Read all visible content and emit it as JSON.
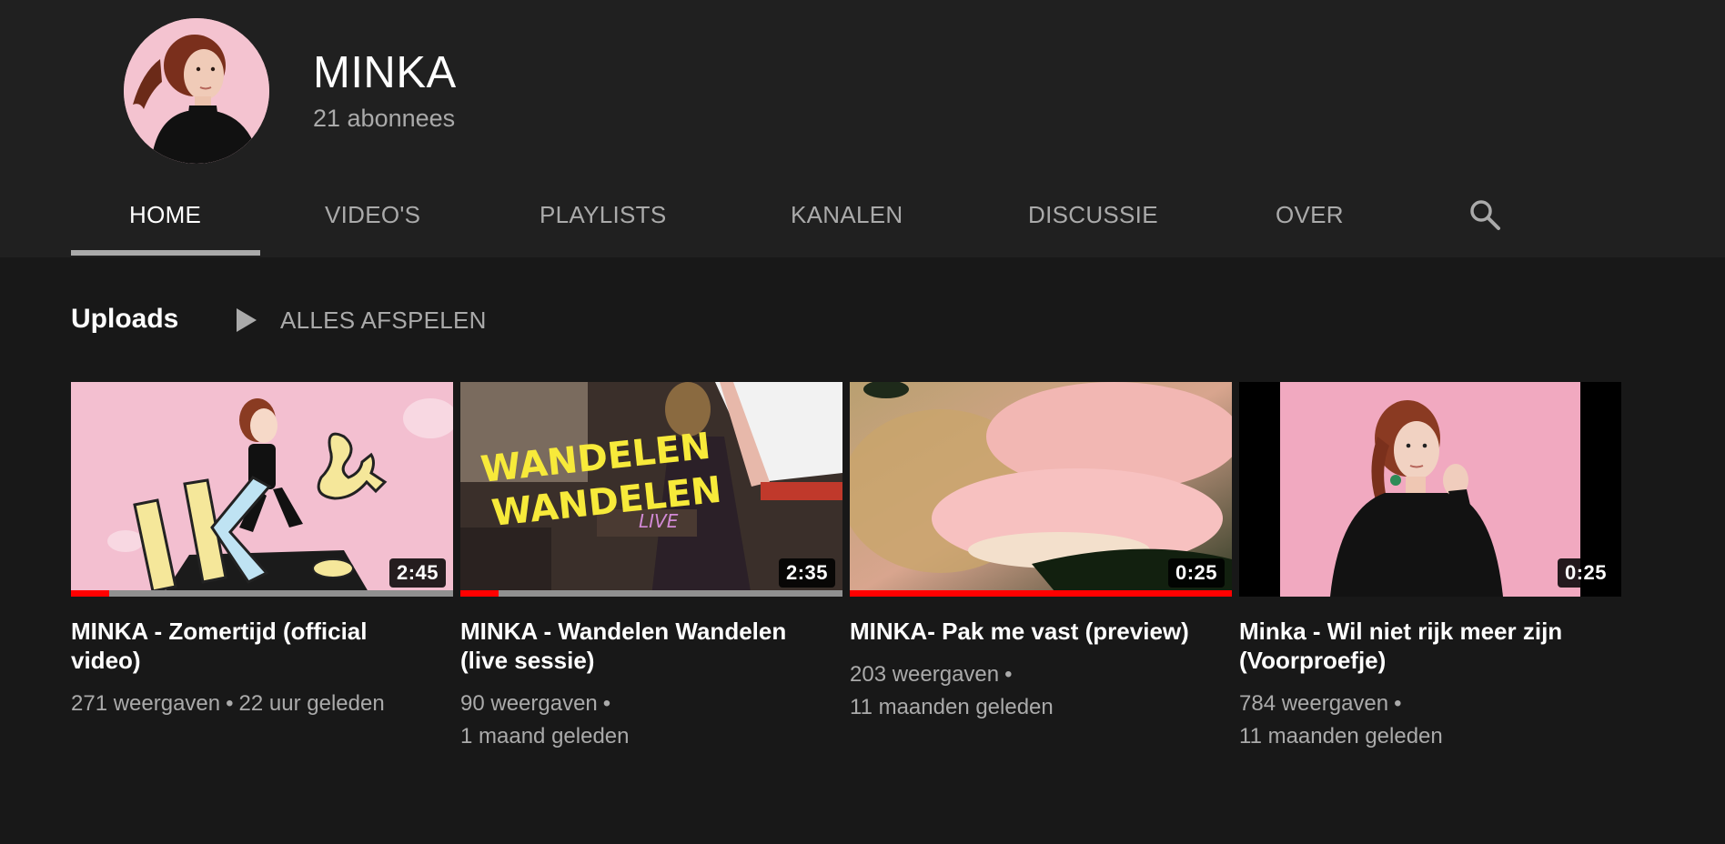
{
  "channel": {
    "name": "MINKA",
    "subscribers": "21 abonnees"
  },
  "tabs": [
    {
      "label": "HOME",
      "active": true
    },
    {
      "label": "VIDEO'S",
      "active": false
    },
    {
      "label": "PLAYLISTS",
      "active": false
    },
    {
      "label": "KANALEN",
      "active": false
    },
    {
      "label": "DISCUSSIE",
      "active": false
    },
    {
      "label": "OVER",
      "active": false
    }
  ],
  "search_icon": "search-icon",
  "shelf": {
    "title": "Uploads",
    "play_all_label": "ALLES AFSPELEN",
    "play_all_icon": "play-icon"
  },
  "videos": [
    {
      "title": "MINKA - Zomertijd (official video)",
      "duration": "2:45",
      "views": "271 weergaven",
      "age": "22 uur geleden",
      "watch_progress": 0.1
    },
    {
      "title": "MINKA - Wandelen Wandelen (live sessie)",
      "duration": "2:35",
      "views": "90 weergaven",
      "age": "1 maand geleden",
      "watch_progress": 0.1
    },
    {
      "title": "MINKA- Pak me vast (preview)",
      "duration": "0:25",
      "views": "203 weergaven",
      "age": "11 maanden geleden",
      "watch_progress": 1.0
    },
    {
      "title": "Minka - Wil niet rijk meer zijn (Voorproefje)",
      "duration": "0:25",
      "views": "784 weergaven",
      "age": "11 maanden geleden",
      "watch_progress": 0
    }
  ],
  "colors": {
    "background": "#181818",
    "header_background": "#202020",
    "progress_red": "#ff0000",
    "secondary_text": "#aaaaaa"
  }
}
